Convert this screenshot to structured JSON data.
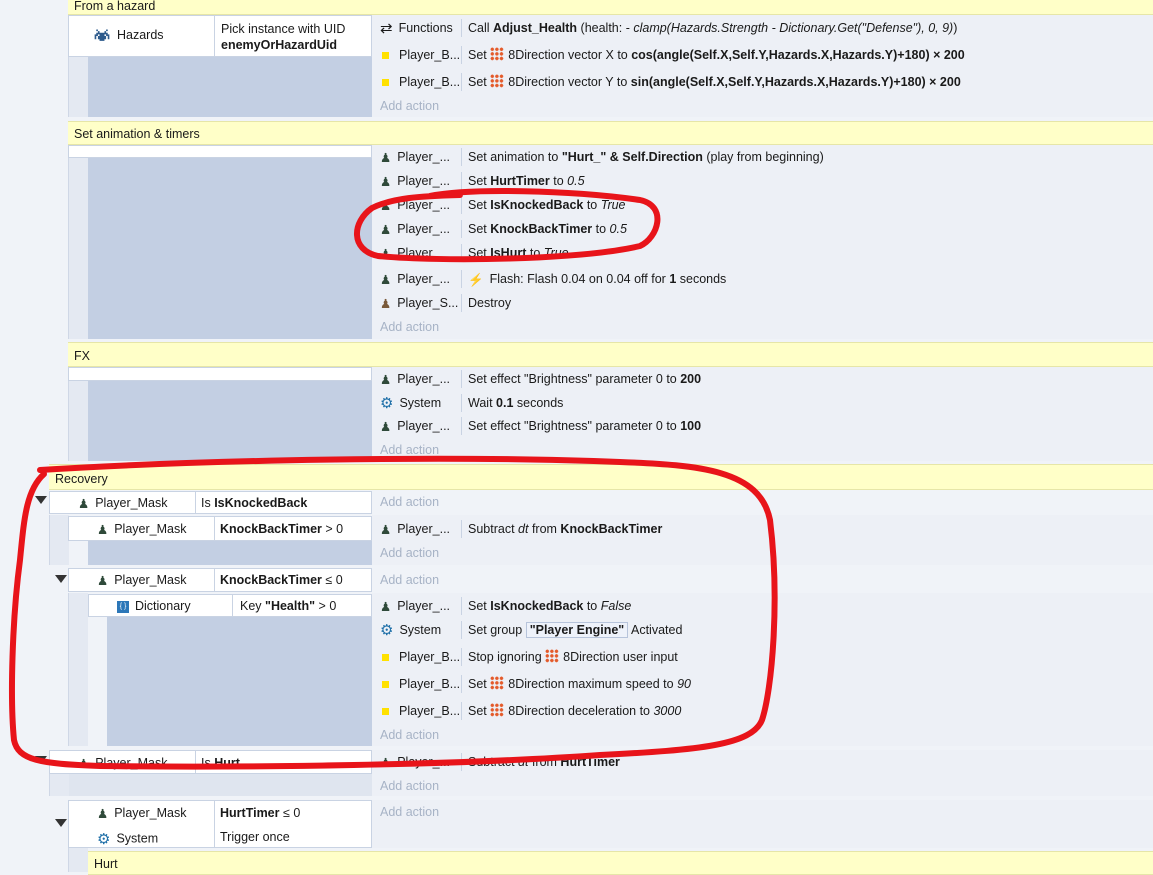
{
  "groups": {
    "from_hazard": "From a hazard",
    "set_anim": "Set animation & timers",
    "fx": "FX",
    "recovery": "Recovery",
    "hurt": "Hurt"
  },
  "add_action": "Add action",
  "ev1": {
    "cond_obj": "Hazards",
    "cond_line1": "Pick instance with UID",
    "cond_line2": "enemyOrHazardUid",
    "a1_obj": "Functions",
    "a1_pre": "Call ",
    "a1_bold": "Adjust_Health",
    "a1_mid": " (health: - ",
    "a1_it": "clamp(Hazards.Strength - Dictionary.Get(\"Defense\"), 0, 9)",
    "a1_end": ")",
    "a2_obj": "Player_B...",
    "a2_pre": "Set ",
    "a2_mid": "8Direction vector X to ",
    "a2_bold": "cos(angle(Self.X,Self.Y,Hazards.X,Hazards.Y)+180) × 200",
    "a3_obj": "Player_B...",
    "a3_pre": "Set ",
    "a3_mid": "8Direction vector Y to ",
    "a3_bold": "sin(angle(Self.X,Self.Y,Hazards.X,Hazards.Y)+180) × 200"
  },
  "ev2": {
    "r1_obj": "Player_...",
    "r1_pre": "Set animation to ",
    "r1_bold": "\"Hurt_\" & Self.Direction",
    "r1_end": " (play from beginning)",
    "r2_obj": "Player_...",
    "r2_pre": "Set ",
    "r2_bold": "HurtTimer",
    "r2_mid": " to ",
    "r2_it": "0.5",
    "r3_obj": "Player_...",
    "r3_pre": "Set ",
    "r3_bold": "IsKnockedBack",
    "r3_mid": " to ",
    "r3_it": "True",
    "r4_obj": "Player_...",
    "r4_pre": "Set ",
    "r4_bold": "KnockBackTimer",
    "r4_mid": " to ",
    "r4_it": "0.5",
    "r5_obj": "Player",
    "r5_pre": "Set ",
    "r5_bold": "IsHurt",
    "r5_mid": " to ",
    "r5_it": "True",
    "r6_obj": "Player_...",
    "r6_pre": "Flash: Flash 0.04 on 0.04 off for ",
    "r6_bold": "1",
    "r6_end": " seconds",
    "r7_obj": "Player_S...",
    "r7_pre": "Destroy"
  },
  "ev3": {
    "r1_obj": "Player_...",
    "r1_pre": "Set effect \"Brightness\" parameter 0 to ",
    "r1_bold": "200",
    "r2_obj": "System",
    "r2_pre": "Wait ",
    "r2_bold": "0.1",
    "r2_end": " seconds",
    "r3_obj": "Player_...",
    "r3_pre": "Set effect \"Brightness\" parameter 0 to ",
    "r3_bold": "100"
  },
  "ev4": {
    "cond_obj": "Player_Mask",
    "cond_pre": "Is ",
    "cond_bold": "IsKnockedBack",
    "sub1_obj": "Player_Mask",
    "sub1_bold": "KnockBackTimer",
    "sub1_end": " > 0",
    "sub1_a_obj": "Player_...",
    "sub1_a_pre": "Subtract ",
    "sub1_a_it": "dt",
    "sub1_a_mid": " from ",
    "sub1_a_bold": "KnockBackTimer",
    "sub2_obj": "Player_Mask",
    "sub2_bold": "KnockBackTimer",
    "sub2_end": " ≤ 0",
    "sub3_obj": "Dictionary",
    "sub3_pre": "Key ",
    "sub3_bold": "\"Health\"",
    "sub3_end": " > 0",
    "a1_obj": "Player_...",
    "a1_pre": "Set ",
    "a1_bold": "IsKnockedBack",
    "a1_mid": " to ",
    "a1_it": "False",
    "a2_obj": "System",
    "a2_pre": "Set group ",
    "a2_bold": "\"Player Engine\"",
    "a2_end": " Activated",
    "a3_obj": "Player_B...",
    "a3_pre": "Stop ignoring ",
    "a3_end": "8Direction user input",
    "a4_obj": "Player_B...",
    "a4_pre": "Set ",
    "a4_mid": "8Direction maximum speed to ",
    "a4_it": "90",
    "a5_obj": "Player_B...",
    "a5_pre": "Set ",
    "a5_mid": "8Direction deceleration to ",
    "a5_it": "3000"
  },
  "ev5": {
    "cond_obj": "Player_Mask",
    "cond_pre": "Is ",
    "cond_bold": "Hurt",
    "a1_obj": "Player_...",
    "a1_pre": "Subtract ",
    "a1_it": "dt",
    "a1_mid": " from ",
    "a1_bold": "HurtTimer",
    "sub1_obj": "Player_Mask",
    "sub1_bold": "HurtTimer",
    "sub1_end": " ≤ 0",
    "sub2_obj": "System",
    "sub2_pre": "Trigger once"
  },
  "colors": {
    "annotation": "#e8141a",
    "group_band": "#ffffc8",
    "condition_blue": "#c3cfe3"
  }
}
